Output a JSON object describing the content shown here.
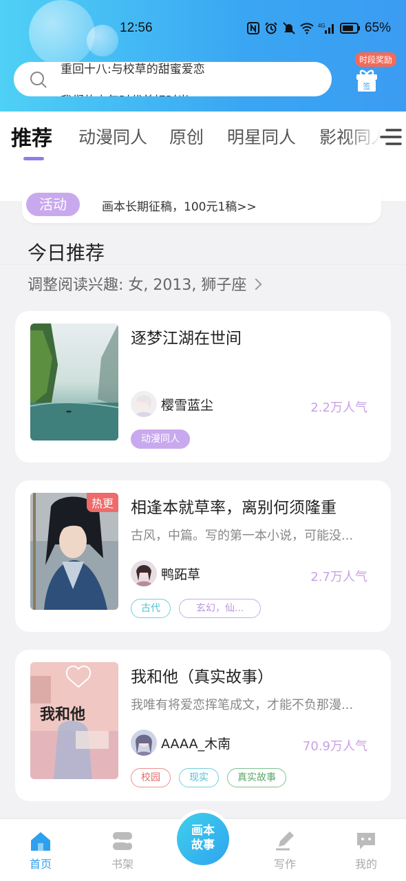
{
  "status_bar": {
    "time": "12:56",
    "battery": "65%"
  },
  "search": {
    "line_prev": "重回十八:与校草的甜蜜爱恋",
    "line_next": "我们的少年时代美好时光"
  },
  "gift": {
    "badge": "时段奖励",
    "box_label": "签"
  },
  "tabs": [
    {
      "label": "推荐",
      "active": true
    },
    {
      "label": "动漫同人"
    },
    {
      "label": "原创"
    },
    {
      "label": "明星同人"
    },
    {
      "label": "影视同人"
    }
  ],
  "activity": {
    "badge": "活动",
    "text": "画本长期征稿，100元1稿>>"
  },
  "today": {
    "title": "今日推荐",
    "interest": "调整阅读兴趣: 女, 2013, 狮子座"
  },
  "cards": [
    {
      "title": "逐梦江湖在世间",
      "desc": "",
      "author": "樱雪蓝尘",
      "popularity": "2.2万人气",
      "hot": "",
      "tags": [
        {
          "label": "动漫同人",
          "style": "filled-purple"
        }
      ]
    },
    {
      "title": "相逢本就草率，离别何须隆重",
      "desc": "古风，中篇。写的第一本小说，可能没...",
      "author": "鸭跖草",
      "popularity": "2.7万人气",
      "hot": "热更",
      "tags": [
        {
          "label": "古代",
          "style": "cyan"
        },
        {
          "label": "玄幻，仙...",
          "style": "purple"
        }
      ]
    },
    {
      "title": "我和他（真实故事）",
      "desc": "我唯有将爱恋挥笔成文，才能不负那漫...",
      "author": "AAAA_木南",
      "popularity": "70.9万人气",
      "hot": "",
      "cover_text": "我和他",
      "tags": [
        {
          "label": "校园",
          "style": "red"
        },
        {
          "label": "现实",
          "style": "cyan"
        },
        {
          "label": "真实故事",
          "style": "green"
        }
      ]
    }
  ],
  "bottom_nav": {
    "home": "首页",
    "shelf": "书架",
    "center_line1": "画本",
    "center_line2": "故事",
    "write": "写作",
    "mine": "我的"
  },
  "colors": {
    "header_gradient_start": "#4fd0f5",
    "header_gradient_end": "#3b9cf2",
    "accent_purple": "#c9a0e6",
    "active_blue": "#2fa0ef",
    "hot_red": "#ee6b6b"
  }
}
